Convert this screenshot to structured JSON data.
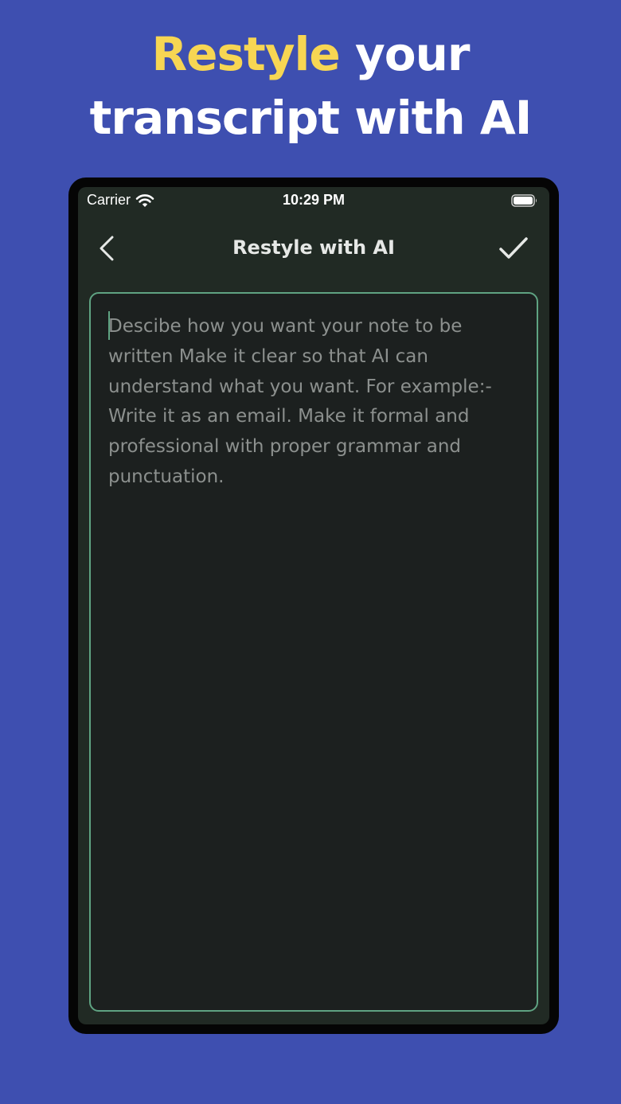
{
  "headline": {
    "accent": "Restyle",
    "line1_rest": " your",
    "line2": "transcript with AI"
  },
  "status_bar": {
    "carrier": "Carrier",
    "time": "10:29 PM",
    "wifi_icon": "wifi-icon",
    "battery_icon": "battery-icon"
  },
  "nav": {
    "title": "Restyle with AI",
    "back_icon": "chevron-left-icon",
    "done_icon": "checkmark-icon"
  },
  "editor": {
    "placeholder": "Descibe how you want your note to be written Make it clear so that AI can understand what you want. For example:- Write it as an email. Make it formal and professional with proper grammar and punctuation."
  },
  "colors": {
    "background": "#3e4fb0",
    "accent": "#f7d653",
    "screen": "#212a24",
    "editor_border": "#5fa382"
  }
}
